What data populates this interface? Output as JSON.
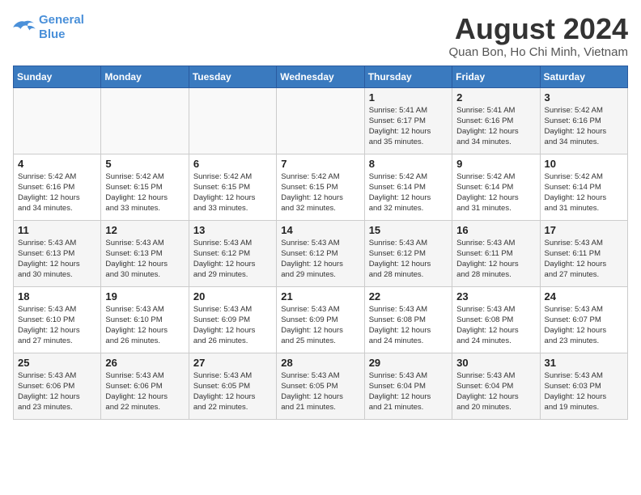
{
  "header": {
    "logo_line1": "General",
    "logo_line2": "Blue",
    "month_title": "August 2024",
    "subtitle": "Quan Bon, Ho Chi Minh, Vietnam"
  },
  "days_of_week": [
    "Sunday",
    "Monday",
    "Tuesday",
    "Wednesday",
    "Thursday",
    "Friday",
    "Saturday"
  ],
  "weeks": [
    [
      {
        "day": "",
        "info": ""
      },
      {
        "day": "",
        "info": ""
      },
      {
        "day": "",
        "info": ""
      },
      {
        "day": "",
        "info": ""
      },
      {
        "day": "1",
        "info": "Sunrise: 5:41 AM\nSunset: 6:17 PM\nDaylight: 12 hours\nand 35 minutes."
      },
      {
        "day": "2",
        "info": "Sunrise: 5:41 AM\nSunset: 6:16 PM\nDaylight: 12 hours\nand 34 minutes."
      },
      {
        "day": "3",
        "info": "Sunrise: 5:42 AM\nSunset: 6:16 PM\nDaylight: 12 hours\nand 34 minutes."
      }
    ],
    [
      {
        "day": "4",
        "info": "Sunrise: 5:42 AM\nSunset: 6:16 PM\nDaylight: 12 hours\nand 34 minutes."
      },
      {
        "day": "5",
        "info": "Sunrise: 5:42 AM\nSunset: 6:15 PM\nDaylight: 12 hours\nand 33 minutes."
      },
      {
        "day": "6",
        "info": "Sunrise: 5:42 AM\nSunset: 6:15 PM\nDaylight: 12 hours\nand 33 minutes."
      },
      {
        "day": "7",
        "info": "Sunrise: 5:42 AM\nSunset: 6:15 PM\nDaylight: 12 hours\nand 32 minutes."
      },
      {
        "day": "8",
        "info": "Sunrise: 5:42 AM\nSunset: 6:14 PM\nDaylight: 12 hours\nand 32 minutes."
      },
      {
        "day": "9",
        "info": "Sunrise: 5:42 AM\nSunset: 6:14 PM\nDaylight: 12 hours\nand 31 minutes."
      },
      {
        "day": "10",
        "info": "Sunrise: 5:42 AM\nSunset: 6:14 PM\nDaylight: 12 hours\nand 31 minutes."
      }
    ],
    [
      {
        "day": "11",
        "info": "Sunrise: 5:43 AM\nSunset: 6:13 PM\nDaylight: 12 hours\nand 30 minutes."
      },
      {
        "day": "12",
        "info": "Sunrise: 5:43 AM\nSunset: 6:13 PM\nDaylight: 12 hours\nand 30 minutes."
      },
      {
        "day": "13",
        "info": "Sunrise: 5:43 AM\nSunset: 6:12 PM\nDaylight: 12 hours\nand 29 minutes."
      },
      {
        "day": "14",
        "info": "Sunrise: 5:43 AM\nSunset: 6:12 PM\nDaylight: 12 hours\nand 29 minutes."
      },
      {
        "day": "15",
        "info": "Sunrise: 5:43 AM\nSunset: 6:12 PM\nDaylight: 12 hours\nand 28 minutes."
      },
      {
        "day": "16",
        "info": "Sunrise: 5:43 AM\nSunset: 6:11 PM\nDaylight: 12 hours\nand 28 minutes."
      },
      {
        "day": "17",
        "info": "Sunrise: 5:43 AM\nSunset: 6:11 PM\nDaylight: 12 hours\nand 27 minutes."
      }
    ],
    [
      {
        "day": "18",
        "info": "Sunrise: 5:43 AM\nSunset: 6:10 PM\nDaylight: 12 hours\nand 27 minutes."
      },
      {
        "day": "19",
        "info": "Sunrise: 5:43 AM\nSunset: 6:10 PM\nDaylight: 12 hours\nand 26 minutes."
      },
      {
        "day": "20",
        "info": "Sunrise: 5:43 AM\nSunset: 6:09 PM\nDaylight: 12 hours\nand 26 minutes."
      },
      {
        "day": "21",
        "info": "Sunrise: 5:43 AM\nSunset: 6:09 PM\nDaylight: 12 hours\nand 25 minutes."
      },
      {
        "day": "22",
        "info": "Sunrise: 5:43 AM\nSunset: 6:08 PM\nDaylight: 12 hours\nand 24 minutes."
      },
      {
        "day": "23",
        "info": "Sunrise: 5:43 AM\nSunset: 6:08 PM\nDaylight: 12 hours\nand 24 minutes."
      },
      {
        "day": "24",
        "info": "Sunrise: 5:43 AM\nSunset: 6:07 PM\nDaylight: 12 hours\nand 23 minutes."
      }
    ],
    [
      {
        "day": "25",
        "info": "Sunrise: 5:43 AM\nSunset: 6:06 PM\nDaylight: 12 hours\nand 23 minutes."
      },
      {
        "day": "26",
        "info": "Sunrise: 5:43 AM\nSunset: 6:06 PM\nDaylight: 12 hours\nand 22 minutes."
      },
      {
        "day": "27",
        "info": "Sunrise: 5:43 AM\nSunset: 6:05 PM\nDaylight: 12 hours\nand 22 minutes."
      },
      {
        "day": "28",
        "info": "Sunrise: 5:43 AM\nSunset: 6:05 PM\nDaylight: 12 hours\nand 21 minutes."
      },
      {
        "day": "29",
        "info": "Sunrise: 5:43 AM\nSunset: 6:04 PM\nDaylight: 12 hours\nand 21 minutes."
      },
      {
        "day": "30",
        "info": "Sunrise: 5:43 AM\nSunset: 6:04 PM\nDaylight: 12 hours\nand 20 minutes."
      },
      {
        "day": "31",
        "info": "Sunrise: 5:43 AM\nSunset: 6:03 PM\nDaylight: 12 hours\nand 19 minutes."
      }
    ]
  ]
}
